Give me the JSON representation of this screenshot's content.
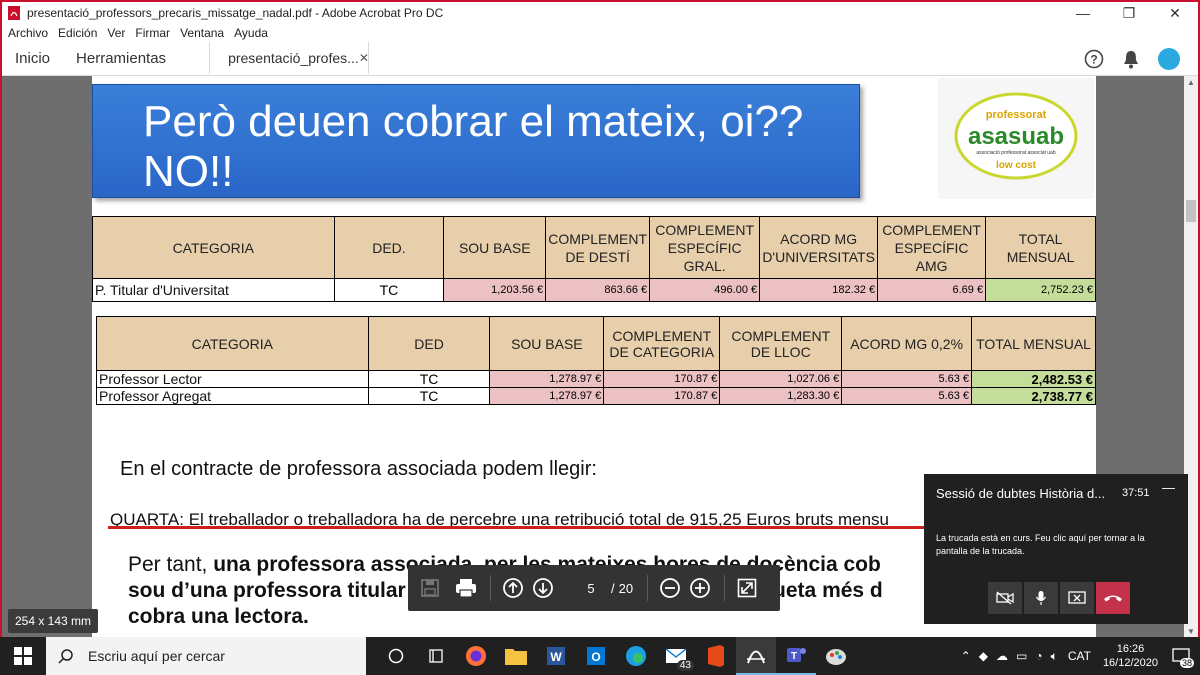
{
  "window": {
    "title": "presentació_professors_precaris_missatge_nadal.pdf - Adobe Acrobat Pro DC",
    "minimize": "—",
    "restore": "❐",
    "close": "✕"
  },
  "menu": [
    "Archivo",
    "Edición",
    "Ver",
    "Firmar",
    "Ventana",
    "Ayuda"
  ],
  "tabs": {
    "home": "Inicio",
    "tools": "Herramientas",
    "document": "presentació_profes...",
    "close": "✕"
  },
  "slide": {
    "title_line1": "Però deuen cobrar el mateix, oi??",
    "title_line2": "NO!!",
    "logo": {
      "top": "professorat",
      "main": "asasuab",
      "sub": "associació professorat associat uab",
      "bottom": "low cost"
    }
  },
  "table1": {
    "headers": [
      "CATEGORIA",
      "DED.",
      "SOU BASE",
      "COMPLEMENT DE DESTÍ",
      "COMPLEMENT ESPECÍFIC GRAL.",
      "ACORD MG D'UNIVERSITATS",
      "COMPLEMENT ESPECÍFIC AMG",
      "TOTAL MENSUAL"
    ],
    "rows": [
      [
        "P. Titular d'Universitat",
        "TC",
        "1,203.56 €",
        "863.66 €",
        "496.00 €",
        "182.32 €",
        "6.69 €",
        "2,752.23 €"
      ]
    ]
  },
  "table2": {
    "headers": [
      "CATEGORIA",
      "DED",
      "SOU BASE",
      "COMPLEMENT DE CATEGORIA",
      "COMPLEMENT DE LLOC",
      "ACORD MG 0,2%",
      "TOTAL MENSUAL"
    ],
    "rows": [
      [
        "Professor Lector",
        "TC",
        "1,278.97 €",
        "170.87 €",
        "1,027.06 €",
        "5.63 €",
        "2,482.53 €"
      ],
      [
        "Professor Agregat",
        "TC",
        "1,278.97 €",
        "170.87 €",
        "1,283.30 €",
        "5.63 €",
        "2,738.77 €"
      ]
    ]
  },
  "body": {
    "p1": "En el contracte de professora associada podem llegir:",
    "p2": "QUARTA: El treballador o treballadora ha de percebre una retribució total de  915,25 Euros  bruts mensu",
    "p3_pre": "Per tant, ",
    "p3_bold1": "una professora associada, per les mateixes hores de docència cob",
    "p3_bold2": "sou d’una professora titular",
    "p3_bold3": "miqueta més d",
    "p3_bold4": "cobra una lectora."
  },
  "toolbar": {
    "page_current": "5",
    "page_sep": "/",
    "page_total": "20"
  },
  "size_tag": "254 x 143 mm",
  "call": {
    "title": "Sessió de dubtes Història d...",
    "time": "37:51",
    "minimize": "—",
    "message": "La trucada està en curs. Feu clic aquí per tornar a la pantalla de la trucada."
  },
  "taskbar": {
    "search_placeholder": "Escriu aquí per cercar",
    "mail_badge": "43",
    "language": "CAT",
    "time": "16:26",
    "date": "16/12/2020",
    "notif_count": "38"
  },
  "colors": {
    "header_fill": "#e7cfac",
    "money_fill": "#ebc1c3",
    "total_fill": "#c4dd9a",
    "slide_blue": "#2f6fd0",
    "underline_red": "#d01e1e",
    "window_border": "#c8102e"
  }
}
